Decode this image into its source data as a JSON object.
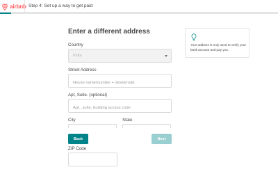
{
  "header": {
    "brand": "airbnb",
    "step_title": "Step 4: Set up a way to get paid",
    "progress": 0.04
  },
  "form": {
    "heading": "Enter a different address",
    "country": {
      "label": "Country",
      "value": "India"
    },
    "street": {
      "label": "Street Address",
      "placeholder": "House name/number + street/road"
    },
    "apt": {
      "label": "Apt, Suite. (optional)",
      "placeholder": "Apt., suite, building access code"
    },
    "city": {
      "label": "City"
    },
    "state": {
      "label": "State"
    },
    "zip": {
      "label": "ZIP Code"
    }
  },
  "buttons": {
    "back": "Back",
    "next": "Next"
  },
  "info": {
    "text": "Your address is only used to verify your bank account and pay you."
  },
  "colors": {
    "brand": "#ff5a5f",
    "accent": "#008489",
    "accent_disabled": "#99cfd1"
  }
}
